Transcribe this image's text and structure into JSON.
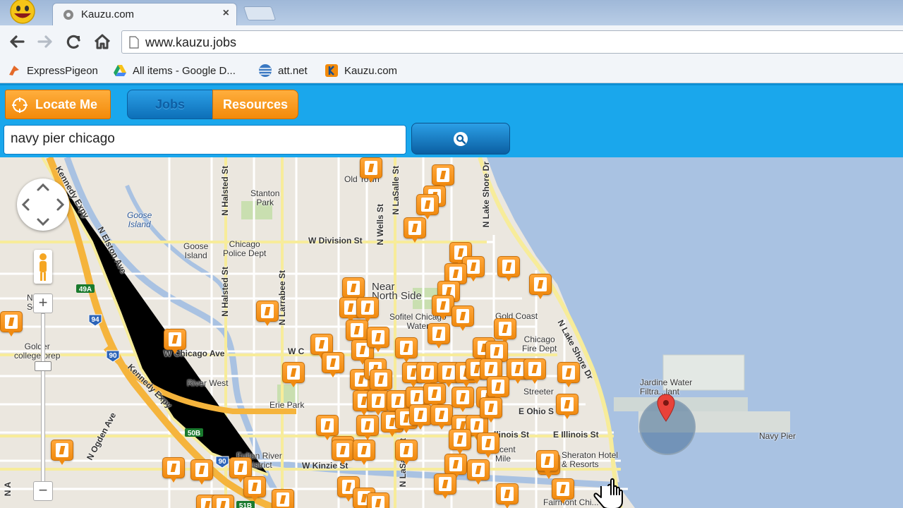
{
  "browser": {
    "tab_title": "Kauzu.com",
    "tab_close": "×",
    "url": "www.kauzu.jobs",
    "bookmarks": [
      {
        "label": "ExpressPigeon",
        "icon": "pigeon-icon"
      },
      {
        "label": "All items - Google D...",
        "icon": "google-drive-icon"
      },
      {
        "label": "att.net",
        "icon": "att-globe-icon"
      },
      {
        "label": "Kauzu.com",
        "icon": "kauzu-icon"
      }
    ]
  },
  "app": {
    "locate_label": "Locate Me",
    "tabs": [
      {
        "label": "Jobs",
        "active": true
      },
      {
        "label": "Resources",
        "active": false
      }
    ],
    "search_value": "navy pier chicago",
    "colors": {
      "bar": "#1aa7ec",
      "accent": "#f28a0a",
      "dark_button": "#0b5fa2"
    }
  },
  "map": {
    "places": {
      "old_town": "Old Town",
      "stanton_park": "Stanton\nPark",
      "goose_island": "Goose\nIsland",
      "goose_island2": "Goose\nIsland",
      "chicago_police": "Chicago\nPolice Dept",
      "near_north_side": "Near\nNorth Side",
      "sofitel": "Sofitel Chicago\nWater",
      "gold_coast": "Gold Coast",
      "chicago_fire": "Chicago\nFire Dept",
      "golder_college": "Golder\ncollege prep",
      "river_west": "River West",
      "erie_park": "Erie Park",
      "streeterville": "Streeter",
      "jardine": "Jardine Water\nFiltra...lant",
      "navy_pier": "Navy Pier",
      "fulton_river": "Fulton River\nDistrict",
      "sheraton": "Sheraton Hotel\n& Resorts",
      "ficent": "ficent\nMile",
      "fairmont": "Fairmont Chi...",
      "n_square": "Nc\nSq...e"
    },
    "streets": {
      "n_halsted_1": "N Halsted St",
      "n_halsted_2": "N Halsted St",
      "n_larrabee": "N Larrabee St",
      "n_lasalle_1": "N LaSalle St",
      "n_lasalle_2": "N LaSalle St",
      "n_wells": "N Wells St",
      "n_lake_shore_1": "N Lake Shore Dr",
      "n_lake_shore_2": "N Lake Shore Dr",
      "w_division": "W Division St",
      "w_chicago": "W Chicago Ave",
      "w_c": "W C",
      "e_ohio": "E Ohio S",
      "e_illinois": "E Illinois St",
      "w_kinzie": "W Kinzie St",
      "n_elston": "N Elston Ave",
      "kennedy_1": "Kennedy Expy",
      "kennedy_2": "Kennedy Expy",
      "n_ogden": "N Ogden Ave",
      "illinois_st": "llinois St",
      "n_a": "N A"
    },
    "shields": [
      "94",
      "90",
      "49A",
      "50B",
      "90",
      "51B"
    ],
    "job_pin_count": 84
  }
}
